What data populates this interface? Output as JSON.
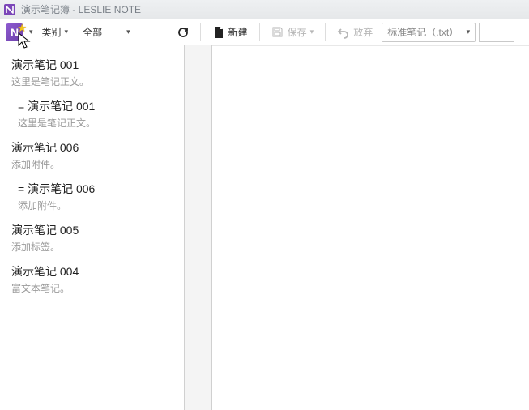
{
  "window": {
    "title": "演示笔记簿 - LESLIE NOTE",
    "app_letter": "N"
  },
  "toolbar": {
    "category_label": "类别",
    "filter_label": "全部",
    "new_label": "新建",
    "save_label": "保存",
    "discard_label": "放弃",
    "type_select": "标准笔记（.txt）"
  },
  "notes": [
    {
      "title": "演示笔记 001",
      "preview": "这里是笔记正文。",
      "indent": false
    },
    {
      "title": "= 演示笔记 001",
      "preview": "这里是笔记正文。",
      "indent": true
    },
    {
      "title": "演示笔记 006",
      "preview": "添加附件。",
      "indent": false
    },
    {
      "title": "= 演示笔记 006",
      "preview": "添加附件。",
      "indent": true
    },
    {
      "title": "演示笔记 005",
      "preview": "添加标签。",
      "indent": false
    },
    {
      "title": "演示笔记 004",
      "preview": "富文本笔记。",
      "indent": false
    }
  ]
}
